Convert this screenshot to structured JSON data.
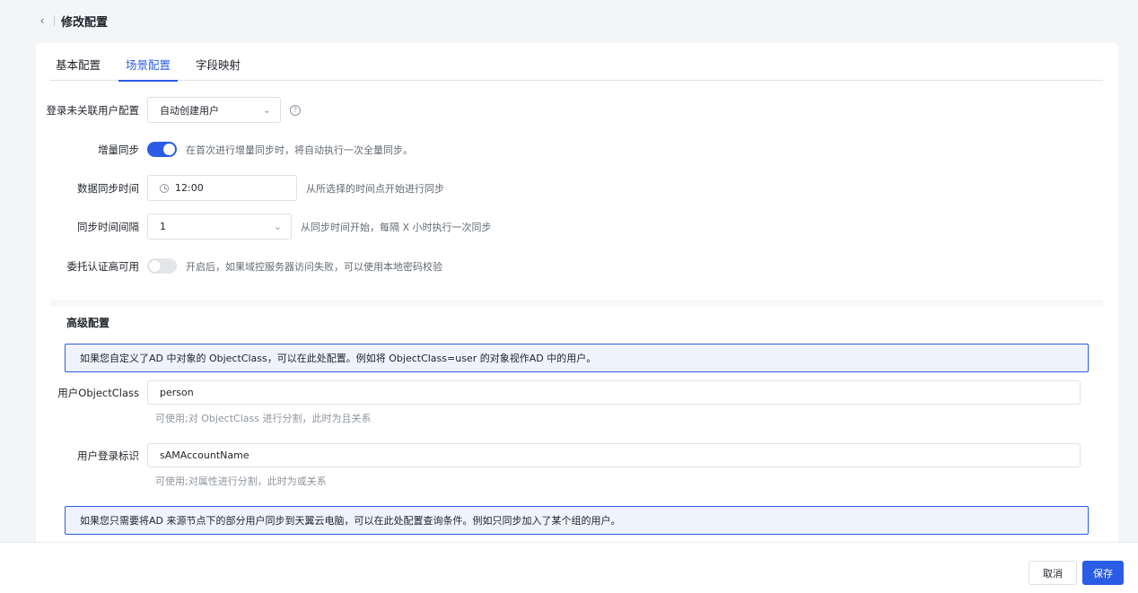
{
  "header": {
    "title": "修改配置"
  },
  "tabs": [
    {
      "label": "基本配置",
      "active": false
    },
    {
      "label": "场景配置",
      "active": true
    },
    {
      "label": "字段映射",
      "active": false
    }
  ],
  "form": {
    "login_unlinked": {
      "label": "登录未关联用户配置",
      "value": "自动创建用户"
    },
    "incremental_sync": {
      "label": "增量同步",
      "enabled": true,
      "hint": "在首次进行增量同步时，将自动执行一次全量同步。"
    },
    "sync_time": {
      "label": "数据同步时间",
      "value": "12:00",
      "hint": "从所选择的时间点开始进行同步"
    },
    "sync_interval": {
      "label": "同步时间间隔",
      "value": "1",
      "hint": "从同步时间开始，每隔 X 小时执行一次同步"
    },
    "delegate_ha": {
      "label": "委托认证高可用",
      "enabled": false,
      "hint": "开启后，如果域控服务器访问失败，可以使用本地密码校验"
    }
  },
  "advanced": {
    "title": "高级配置",
    "info1": "如果您自定义了AD 中对象的 ObjectClass，可以在此处配置。例如将 ObjectClass=user 的对象视作AD 中的用户。",
    "object_class": {
      "label": "用户ObjectClass",
      "value": "person",
      "hint": "可使用;对 ObjectClass 进行分割，此时为且关系"
    },
    "login_id": {
      "label": "用户登录标识",
      "value": "sAMAccountName",
      "hint": "可使用;对属性进行分割，此时为或关系"
    },
    "info2": "如果您只需要将AD 来源节点下的部分用户同步到天翼云电脑，可以在此处配置查询条件。例如只同步加入了某个组的用户。"
  },
  "footer": {
    "cancel_label": "取消",
    "save_label": "保存"
  },
  "colors": {
    "accent": "#2b5ce5",
    "info_bg": "#eef3fe"
  }
}
